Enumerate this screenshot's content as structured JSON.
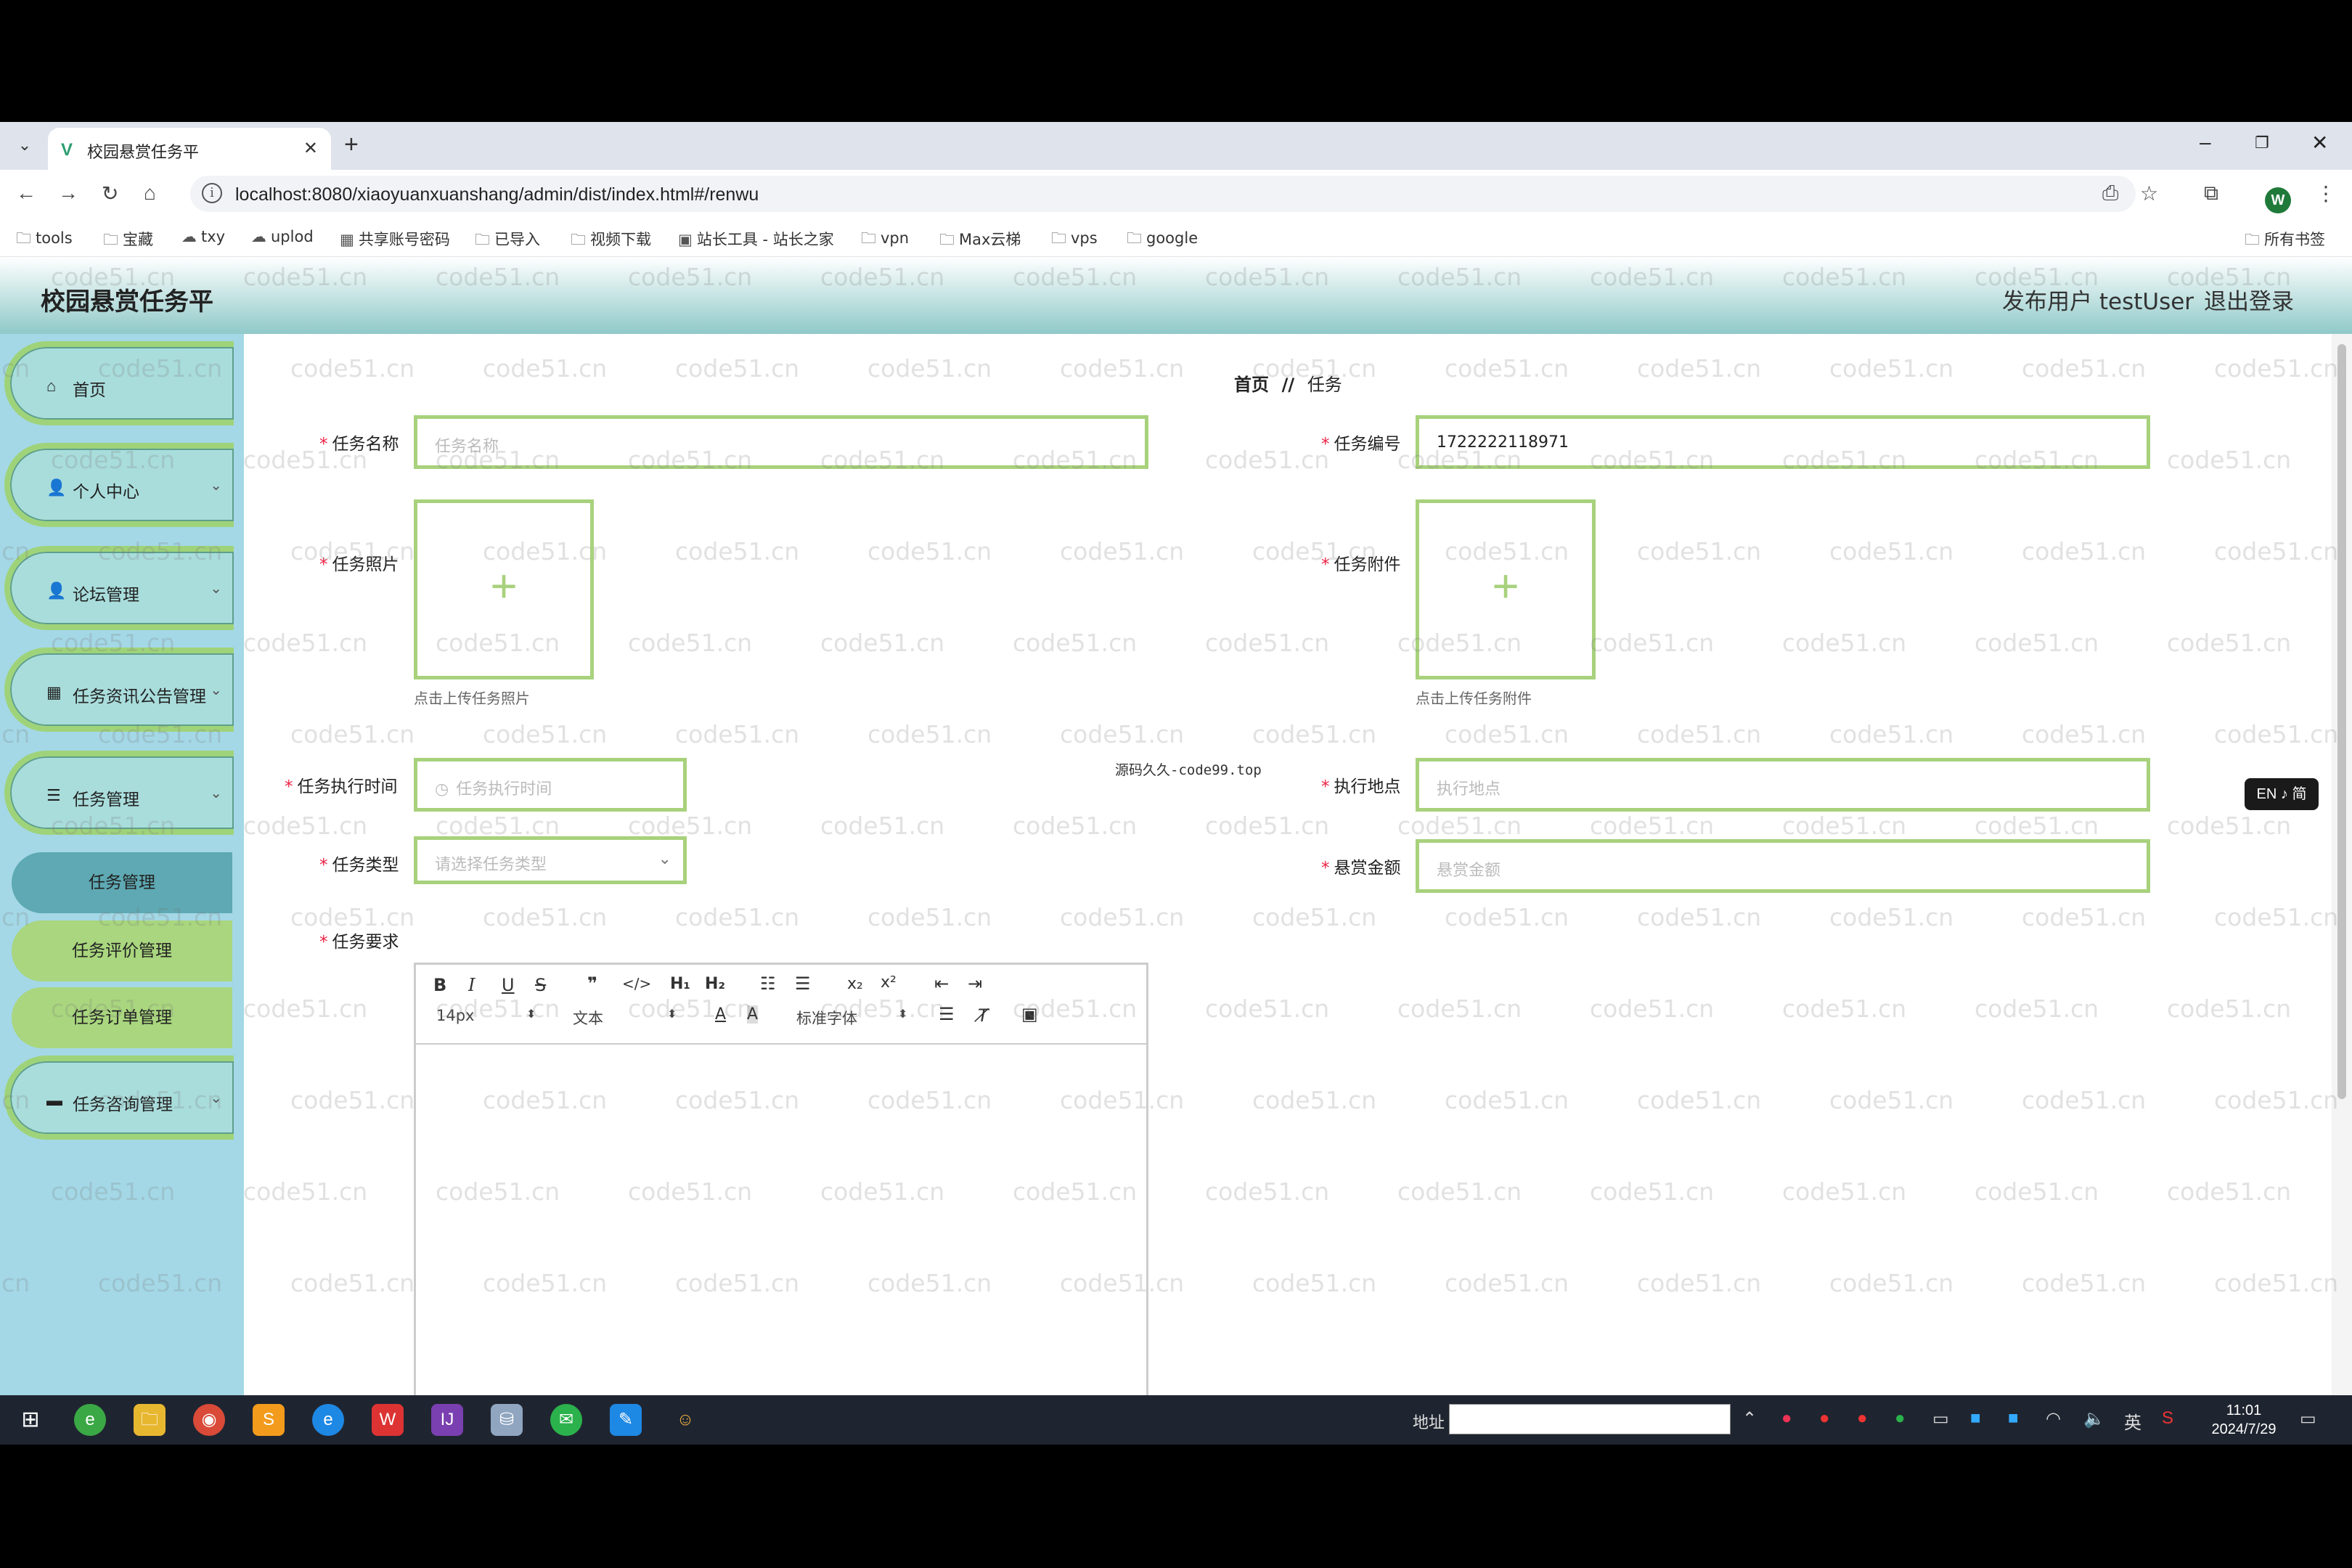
{
  "browser": {
    "tab_title": "校园悬赏任务平",
    "url": "localhost:8080/xiaoyuanxuanshang/admin/dist/index.html#/renwu",
    "profile_initial": "W",
    "bookmarks": [
      "tools",
      "宝藏",
      "txy",
      "uplod",
      "共享账号密码",
      "已导入",
      "视频下载",
      "站长工具 - 站长之家",
      "vpn",
      "Max云梯",
      "vps",
      "google"
    ],
    "all_bookmarks": "所有书签"
  },
  "app": {
    "title": "校园悬赏任务平",
    "user_label": "发布用户 testUser",
    "logout": "退出登录"
  },
  "sidebar": {
    "items": [
      {
        "label": "首页",
        "icon": "home-icon",
        "glyph": "⌂"
      },
      {
        "label": "个人中心",
        "icon": "person-icon",
        "glyph": "👤"
      },
      {
        "label": "论坛管理",
        "icon": "person-icon",
        "glyph": "👤"
      },
      {
        "label": "任务资讯公告管理",
        "icon": "grid-icon",
        "glyph": "▦"
      },
      {
        "label": "任务管理",
        "icon": "list-icon",
        "glyph": "☰"
      },
      {
        "label": "任务咨询管理",
        "icon": "briefcase-icon",
        "glyph": "▬"
      }
    ],
    "sub_items": [
      "任务管理",
      "任务评价管理",
      "任务订单管理"
    ]
  },
  "breadcrumb": {
    "home": "首页",
    "sep": "//",
    "current": "任务"
  },
  "form": {
    "task_name_label": "任务名称",
    "task_name_placeholder": "任务名称",
    "task_no_label": "任务编号",
    "task_no_value": "1722222118971",
    "task_photo_label": "任务照片",
    "task_photo_hint": "点击上传任务照片",
    "task_attach_label": "任务附件",
    "task_attach_hint": "点击上传任务附件",
    "exec_time_label": "任务执行时间",
    "exec_time_placeholder": "任务执行时间",
    "location_label": "执行地点",
    "location_placeholder": "执行地点",
    "type_label": "任务类型",
    "type_placeholder": "请选择任务类型",
    "reward_label": "悬赏金额",
    "reward_placeholder": "悬赏金额",
    "requirements_label": "任务要求"
  },
  "editor": {
    "font_size": "14px",
    "text_style": "文本",
    "font_family": "标准字体"
  },
  "overlay_note": "源码久久-code99.top",
  "watermark": "code51.cn",
  "lang_badge": "EN ♪ 简",
  "taskbar": {
    "addr_label": "地址",
    "ime": "英",
    "time": "11:01",
    "date": "2024/7/29"
  },
  "colors": {
    "accent_green": "#a8d17c",
    "sidebar_bg": "#a4d8e6",
    "header_teal": "#8fc9c8",
    "active_sub": "#5ea9b3",
    "sub_green": "#a9d67e"
  }
}
